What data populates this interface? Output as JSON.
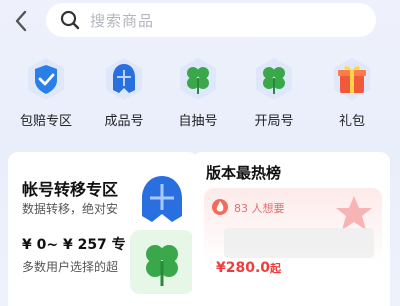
{
  "search": {
    "placeholder": "搜索商品"
  },
  "categories": [
    {
      "label": "包赔专区",
      "icon": "shield-check-icon"
    },
    {
      "label": "成品号",
      "icon": "knight-helmet-icon"
    },
    {
      "label": "自抽号",
      "icon": "clover-icon"
    },
    {
      "label": "开局号",
      "icon": "clover-icon"
    },
    {
      "label": "礼包",
      "icon": "gift-icon"
    }
  ],
  "left_card": {
    "title": "帐号转移专区",
    "subtitle": "数据转移，绝对安",
    "price": "¥ 0~ ¥ 257 专",
    "subtitle2": "多数用户选择的超"
  },
  "right_card": {
    "title": "版本最热榜",
    "hot_label": "83 人想要",
    "price": "¥280.0",
    "price_suffix": "起"
  },
  "colors": {
    "accent_red": "#ee3d3d",
    "clover_green": "#3aa84a",
    "shield_blue": "#2a7ee8"
  }
}
